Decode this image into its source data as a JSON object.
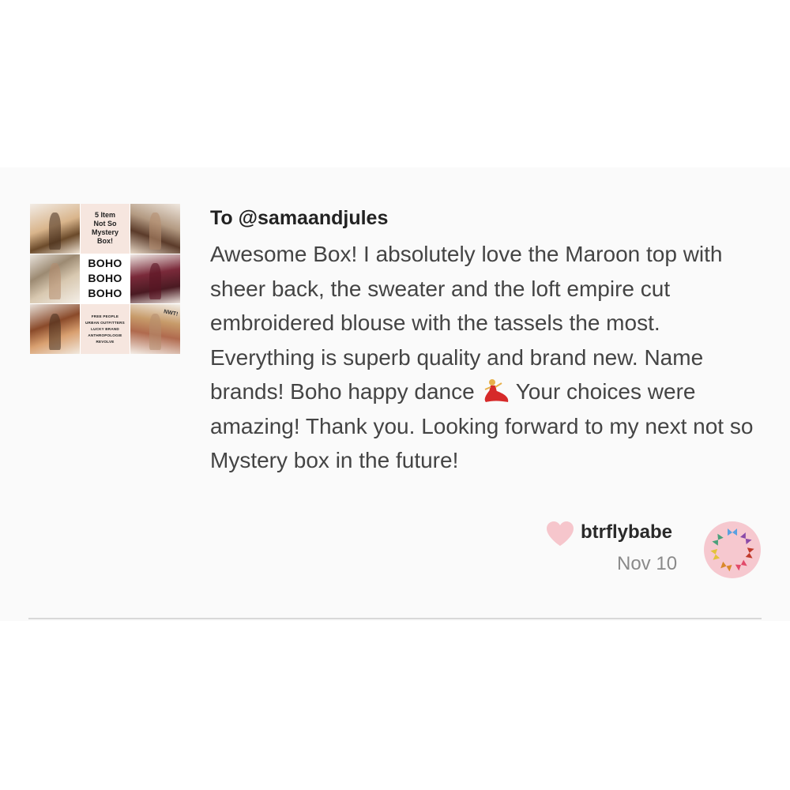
{
  "listing_image": {
    "promo_top": [
      "5 Item",
      "Not So",
      "Mystery",
      "Box!"
    ],
    "promo_mid": [
      "BOHO",
      "BOHO",
      "BOHO"
    ],
    "promo_brands": [
      "FREE PEOPLE",
      "URBAN OUTFITTERS",
      "LUCKY BRAND",
      "ANTHROPOLOGIE",
      "REVOLVE"
    ],
    "nwt_label": "NWT!"
  },
  "review": {
    "title": "To @samaandjules",
    "body_before_emoji": "Awesome Box! I absolutely love the Maroon top with sheer back, the sweater and the loft empire cut embroidered blouse with the tassels the most. Everything is superb quality and brand new. Name brands! Boho happy dance",
    "emoji_name": "dancer-icon",
    "body_after_emoji": "Your choices were amazing! Thank you. Looking forward to my next not so Mystery box in the future!"
  },
  "reviewer": {
    "name": "btrflybabe",
    "date": "Nov 10",
    "heart_icon": "heart-icon",
    "avatar_icon": "butterfly-avatar-icon"
  },
  "colors": {
    "card_bg": "#fafafa",
    "heart": "#f6c6cc",
    "avatar_bg": "#f6c8cf",
    "text_primary": "#222222",
    "text_secondary": "#8a8a8a"
  }
}
